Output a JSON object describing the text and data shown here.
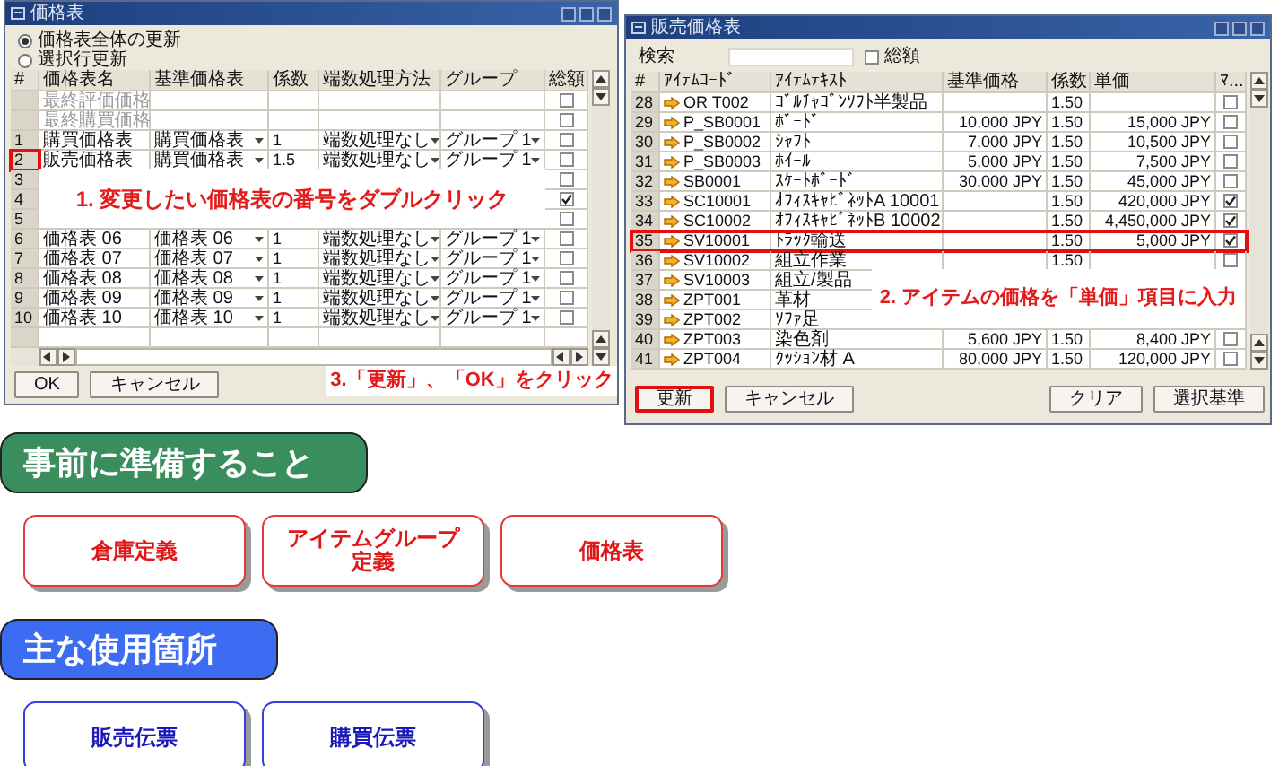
{
  "price_list_window": {
    "title": "価格表",
    "radios": [
      {
        "label": "価格表全体の更新",
        "selected": true
      },
      {
        "label": "選択行更新",
        "selected": false
      }
    ],
    "columns": [
      "#",
      "価格表名",
      "基準価格表",
      "係数",
      "端数処理方法",
      "グループ",
      "総額"
    ],
    "special_rows": [
      {
        "name": "最終評価価格",
        "checked": false
      },
      {
        "name": "最終購買価格",
        "checked": false
      }
    ],
    "rows": [
      {
        "num": "1",
        "name": "購買価格表",
        "base": "購買価格表",
        "factor": "1",
        "method": "端数処理なし",
        "group": "グループ 1",
        "checked": false,
        "marked": false
      },
      {
        "num": "2",
        "name": "販売価格表",
        "base": "購買価格表",
        "factor": "1.5",
        "method": "端数処理なし",
        "group": "グループ 1",
        "checked": false,
        "marked": true
      },
      {
        "num": "3",
        "checked": false,
        "marked": false
      },
      {
        "num": "4",
        "checked": true,
        "marked": false
      },
      {
        "num": "5",
        "checked": false,
        "marked": false
      },
      {
        "num": "6",
        "name": "価格表 06",
        "base": "価格表 06",
        "factor": "1",
        "method": "端数処理なし",
        "group": "グループ 1",
        "checked": false,
        "marked": false
      },
      {
        "num": "7",
        "name": "価格表 07",
        "base": "価格表 07",
        "factor": "1",
        "method": "端数処理なし",
        "group": "グループ 1",
        "checked": false,
        "marked": false
      },
      {
        "num": "8",
        "name": "価格表 08",
        "base": "価格表 08",
        "factor": "1",
        "method": "端数処理なし",
        "group": "グループ 1",
        "checked": false,
        "marked": false
      },
      {
        "num": "9",
        "name": "価格表 09",
        "base": "価格表 09",
        "factor": "1",
        "method": "端数処理なし",
        "group": "グループ 1",
        "checked": false,
        "marked": false
      },
      {
        "num": "10",
        "name": "価格表 10",
        "base": "価格表 10",
        "factor": "1",
        "method": "端数処理なし",
        "group": "グループ 1",
        "checked": false,
        "marked": false
      }
    ],
    "buttons": [
      "OK",
      "キャンセル"
    ]
  },
  "sales_price_window": {
    "title": "販売価格表",
    "search": {
      "label": "検索"
    },
    "filter_checkbox": {
      "label": "総額",
      "checked": false
    },
    "columns": [
      "#",
      "ｱｲﾃﾑｺｰﾄﾞ",
      "ｱｲﾃﾑﾃｷｽﾄ",
      "基準価格",
      "係数",
      "単価",
      "ﾏ..."
    ],
    "rows": [
      {
        "num": "28",
        "code": "OR T002",
        "text": "ｺﾞﾙﾁｬｺﾞﾝｿﾌﾄ半製品",
        "base_price": "",
        "factor": "1.50",
        "unit_price": "",
        "checked": false,
        "marked": false
      },
      {
        "num": "29",
        "code": "P_SB0001",
        "text": "ﾎﾞｰﾄﾞ",
        "base_price": "10,000 JPY",
        "factor": "1.50",
        "unit_price": "15,000 JPY",
        "checked": false,
        "marked": false
      },
      {
        "num": "30",
        "code": "P_SB0002",
        "text": "ｼｬﾌﾄ",
        "base_price": "7,000 JPY",
        "factor": "1.50",
        "unit_price": "10,500 JPY",
        "checked": false,
        "marked": false
      },
      {
        "num": "31",
        "code": "P_SB0003",
        "text": "ﾎｲｰﾙ",
        "base_price": "5,000 JPY",
        "factor": "1.50",
        "unit_price": "7,500 JPY",
        "checked": false,
        "marked": false
      },
      {
        "num": "32",
        "code": "SB0001",
        "text": "ｽｹｰﾄﾎﾞｰﾄﾞ",
        "base_price": "30,000 JPY",
        "factor": "1.50",
        "unit_price": "45,000 JPY",
        "checked": false,
        "marked": false
      },
      {
        "num": "33",
        "code": "SC10001",
        "text": "ｵﾌｨｽｷｬﾋﾞﾈｯﾄA 10001",
        "base_price": "",
        "factor": "1.50",
        "unit_price": "420,000 JPY",
        "checked": true,
        "marked": false
      },
      {
        "num": "34",
        "code": "SC10002",
        "text": "ｵﾌｨｽｷｬﾋﾞﾈｯﾄB 10002",
        "base_price": "",
        "factor": "1.50",
        "unit_price": "4,450,000 JPY",
        "checked": true,
        "marked": false
      },
      {
        "num": "35",
        "code": "SV10001",
        "text": "ﾄﾗｯｸ輸送",
        "base_price": "",
        "factor": "1.50",
        "unit_price": "5,000 JPY",
        "checked": true,
        "marked": true
      },
      {
        "num": "36",
        "code": "SV10002",
        "text": "組立作業",
        "base_price": "",
        "factor": "1.50",
        "unit_price": "",
        "checked": false,
        "marked": false
      },
      {
        "num": "37",
        "code": "SV10003",
        "text": "組立/製品",
        "marked": false
      },
      {
        "num": "38",
        "code": "ZPT001",
        "text": "革材",
        "marked": false
      },
      {
        "num": "39",
        "code": "ZPT002",
        "text": "ｿﾌｧ足",
        "marked": false
      },
      {
        "num": "40",
        "code": "ZPT003",
        "text": "染色剤",
        "base_price": "5,600 JPY",
        "factor": "1.50",
        "unit_price": "8,400 JPY",
        "checked": false,
        "marked": false
      },
      {
        "num": "41",
        "code": "ZPT004",
        "text": "ｸｯｼｮﾝ材 A",
        "base_price": "80,000 JPY",
        "factor": "1.50",
        "unit_price": "120,000 JPY",
        "checked": false,
        "marked": false
      }
    ],
    "buttons": [
      {
        "label": "更新",
        "marked": true
      },
      {
        "label": "キャンセル",
        "marked": false
      },
      {
        "label": "クリア",
        "marked": false
      },
      {
        "label": "選択基準",
        "marked": false
      }
    ]
  },
  "callouts": [
    "1. 変更したい価格表の番号をダブルクリック",
    "2. アイテムの価格を「単価」項目に入力",
    "3.「更新」、「OK」をクリック"
  ],
  "sections": [
    {
      "heading": "事前に準備すること",
      "kind": "prep",
      "items": [
        "倉庫定義",
        "アイテムグループ定義",
        "価格表"
      ]
    },
    {
      "heading": "主な使用箇所",
      "kind": "usage",
      "items": [
        "販売伝票",
        "購買伝票"
      ]
    }
  ]
}
